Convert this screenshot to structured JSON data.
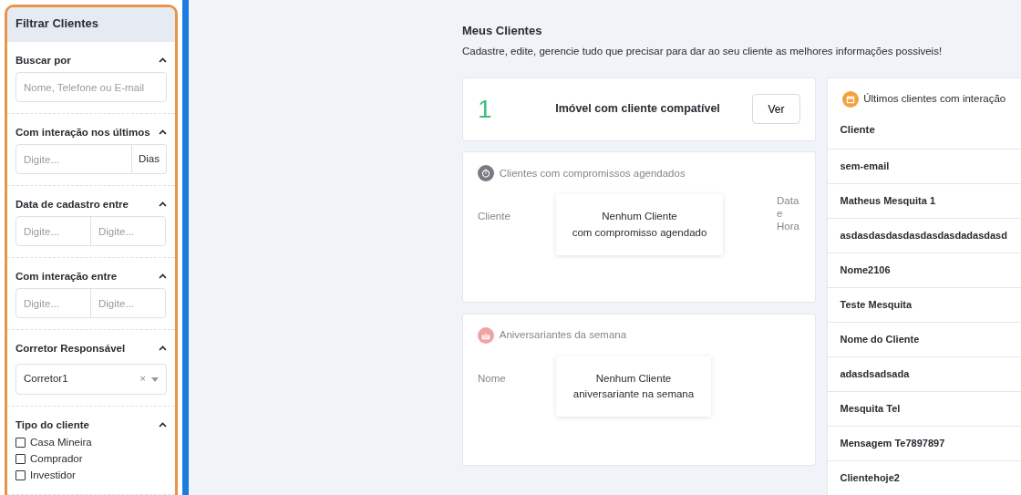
{
  "sidebar": {
    "title": "Filtrar Clientes",
    "sections": [
      {
        "kind": "text",
        "label": "Buscar por",
        "expanded": true,
        "placeholder": "Nome, Telefone ou E-mail"
      },
      {
        "kind": "addon",
        "label": "Com interação nos últimos",
        "expanded": true,
        "placeholder": "Digite...",
        "addon": "Dias"
      },
      {
        "kind": "range",
        "label": "Data de cadastro entre",
        "expanded": true,
        "placeholders": [
          "Digite...",
          "Digite..."
        ]
      },
      {
        "kind": "range",
        "label": "Com interação entre",
        "expanded": true,
        "placeholders": [
          "Digite...",
          "Digite..."
        ]
      },
      {
        "kind": "select",
        "label": "Corretor Responsável",
        "expanded": true,
        "value": "Corretor1",
        "clear": "×"
      },
      {
        "kind": "checks",
        "label": "Tipo do cliente",
        "expanded": true,
        "options": [
          {
            "label": "Casa Mineira",
            "checked": false
          },
          {
            "label": "Comprador",
            "checked": false
          },
          {
            "label": "Investidor",
            "checked": false
          }
        ]
      }
    ]
  },
  "page": {
    "title": "Meus Clientes",
    "subtitle": "Cadastre, edite, gerencie tudo que precisar para dar ao seu cliente as melhores informações possiveis!"
  },
  "match_card": {
    "count": "1",
    "text": "Imóvel com cliente compatível",
    "button": "Ver"
  },
  "schedule_card": {
    "title": "Clientes com compromissos agendados",
    "columns": [
      "Cliente",
      "Data e Hora"
    ],
    "empty": [
      "Nenhum Cliente",
      "com compromisso agendado"
    ]
  },
  "birthday_card": {
    "title": "Aniversariantes da semana",
    "columns": [
      "Nome"
    ],
    "empty": [
      "Nenhum Cliente",
      "aniversariante na semana"
    ]
  },
  "recent_card": {
    "title": "Últimos clientes com interação",
    "column": "Cliente",
    "rows": [
      "sem-email",
      "Matheus Mesquita 1",
      "asdasdasdasdasdasdasdadasdasd",
      "Nome2106",
      "Teste Mesquita",
      "Nome do Cliente",
      "adasdsadsada",
      "Mesquita Tel",
      "Mensagem Te7897897",
      "Clientehoje2"
    ]
  }
}
